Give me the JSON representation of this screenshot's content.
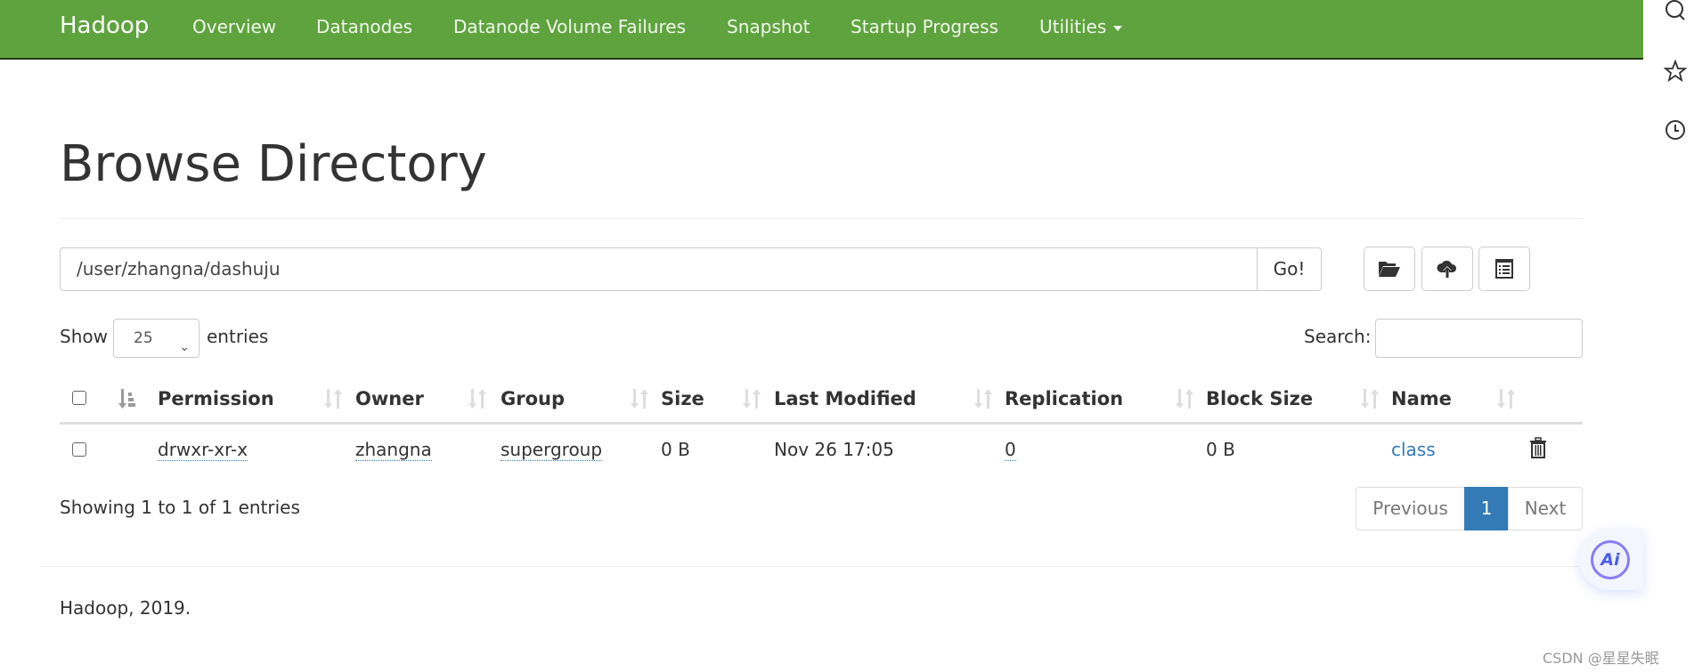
{
  "navbar": {
    "brand": "Hadoop",
    "items": [
      "Overview",
      "Datanodes",
      "Datanode Volume Failures",
      "Snapshot",
      "Startup Progress",
      "Utilities"
    ],
    "color": "#5fa33e"
  },
  "page_title": "Browse Directory",
  "path_bar": {
    "value": "/user/zhangna/dashuju",
    "go_label": "Go!"
  },
  "toolbar": {
    "icons": [
      "folder-open-icon",
      "cloud-upload-icon",
      "list-icon"
    ]
  },
  "table_controls": {
    "show_label": "Show",
    "entries_value": "25",
    "entries_label": "entries",
    "search_label": "Search:",
    "search_value": ""
  },
  "table": {
    "columns": [
      "Permission",
      "Owner",
      "Group",
      "Size",
      "Last Modified",
      "Replication",
      "Block Size",
      "Name"
    ],
    "rows": [
      {
        "permission": "drwxr-xr-x",
        "owner": "zhangna",
        "group": "supergroup",
        "size": "0 B",
        "last_modified": "Nov 26 17:05",
        "replication": "0",
        "block_size": "0 B",
        "name": "class"
      }
    ]
  },
  "info": "Showing 1 to 1 of 1 entries",
  "pagination": {
    "previous": "Previous",
    "current": "1",
    "next": "Next",
    "active_color": "#337ab7"
  },
  "footer": "Hadoop, 2019.",
  "ai_button": "Ai",
  "watermark": "CSDN @星星失眠"
}
